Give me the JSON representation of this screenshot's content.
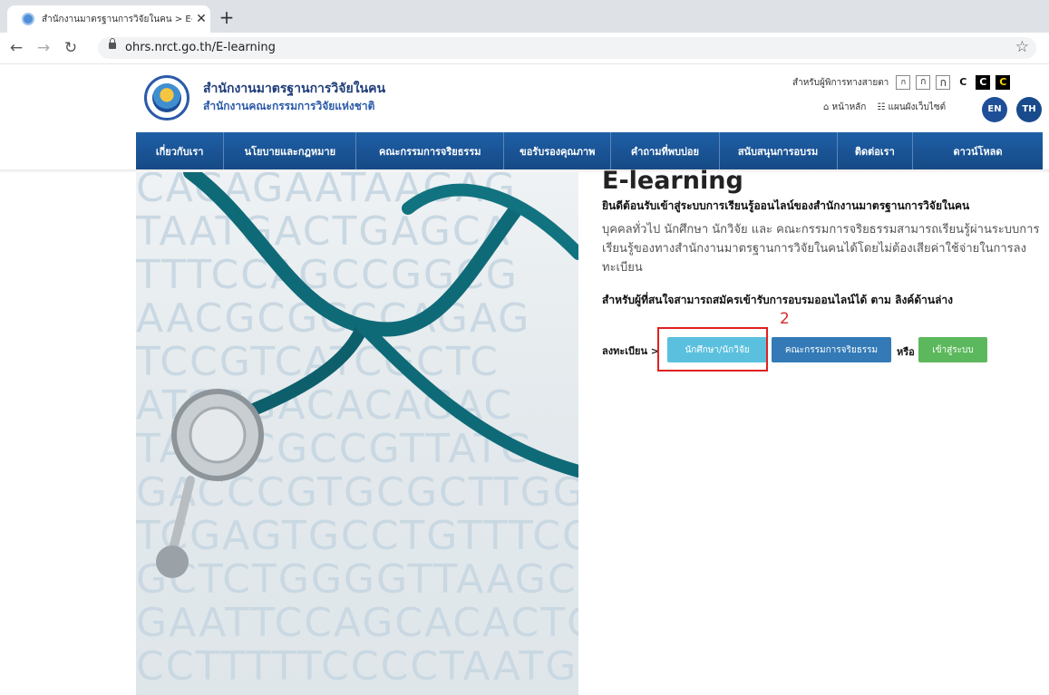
{
  "browser": {
    "tab_title": "สำนักงานมาตรฐานการวิจัยในคน > E-l",
    "url": "ohrs.nrct.go.th/E-learning"
  },
  "header": {
    "org_name_1": "สำนักงานมาตรฐานการวิจัยในคน",
    "org_name_2": "สำนักงานคณะกรรมการวิจัยแห่งชาติ",
    "accessibility_label": "สำหรับผู้พิการทางสายตา",
    "font_sizes": [
      "ก",
      "ก",
      "ก"
    ],
    "contrast": [
      "C",
      "C",
      "C"
    ],
    "home_link": "หน้าหลัก",
    "sitemap_link": "แผนผังเว็บไซต์",
    "lang_en": "EN",
    "lang_th": "TH"
  },
  "nav": {
    "items": [
      "เกี่ยวกับเรา",
      "นโยบายและกฎหมาย",
      "คณะกรรมการจริยธรรม",
      "ขอรับรองคุณภาพ",
      "คำถามที่พบบ่อย",
      "สนับสนุนการอบรม",
      "ติดต่อเรา",
      "ดาวน์โหลด"
    ]
  },
  "hero": {
    "dna_lines": [
      "CACAGAATAAGAG",
      "TAATGACTGAGCA",
      "TTTCCAGCCGGCG",
      "AACGCGCCCAGAG",
      "TCCGTCATCGCTC",
      "ATCCGACACAGAC",
      "TACCCGCCGTTATG",
      "GACCCGTGCGCTTGG",
      "TCGAGTGCCTGTTTCCC",
      "GCTCTGGGGTTAAGCGA",
      "GAATTCCAGCACACTGG",
      "CCTTTTTCCCCTAATGG"
    ]
  },
  "content": {
    "title": "E-learning",
    "welcome": "ยินดีต้อนรับเข้าสู่ระบบการเรียนรู้ออนไลน์ของสำนักงานมาตรฐานการวิจัยในคน",
    "body": "บุคคลทั่วไป นักศึกษา นักวิจัย และ คณะกรรมการจริยธรรมสามารถเรียนรู้ผ่านระบบการเรียนรู้ของทางสำนักงานมาตรฐานการวิจัยในคนได้โดยไม่ต้องเสียค่าใช้จ่ายในการลงทะเบียน",
    "note": "สำหรับผู้ที่สนใจสามารถสมัครเข้ารับการอบรมออนไลน์ได้ ตาม ลิงค์ด้านล่าง",
    "register_label": "ลงทะเบียน >",
    "btn_student": "นักศึกษา/นักวิจัย",
    "btn_committee": "คณะกรรมการจริยธรรม",
    "or": "หรือ",
    "btn_login": "เข้าสู่ระบบ",
    "annotation": "2"
  }
}
